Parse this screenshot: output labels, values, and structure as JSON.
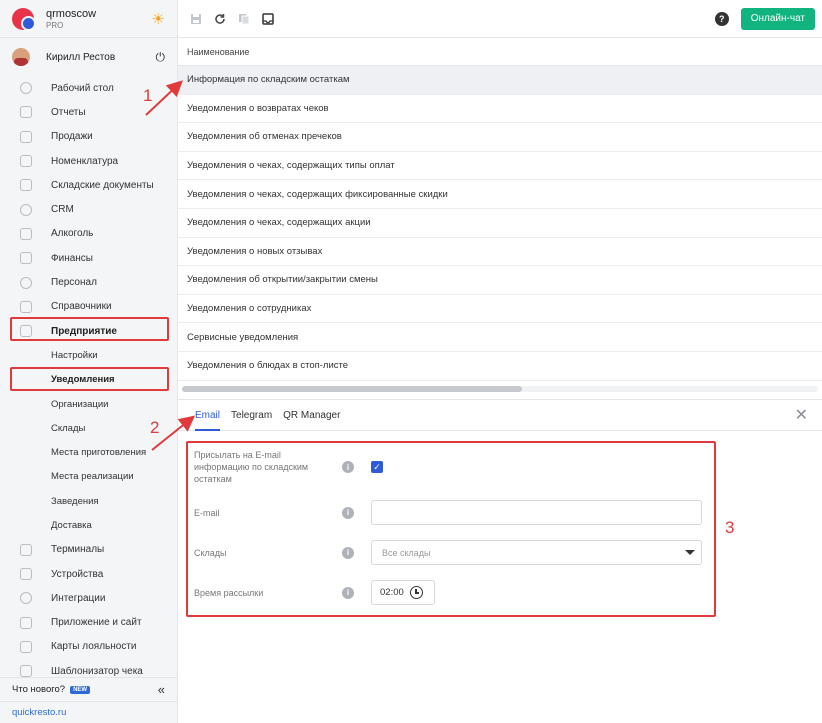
{
  "brand": {
    "name": "qrmoscow",
    "plan": "PRO",
    "theme_icon": "sun-icon"
  },
  "user": {
    "name": "Кирилл Рестов",
    "logout_icon": "power-icon"
  },
  "sidebar": {
    "items": [
      {
        "label": "Рабочий стол",
        "icon": "dashboard-icon"
      },
      {
        "label": "Отчеты",
        "icon": "chart-icon"
      },
      {
        "label": "Продажи",
        "icon": "cart-icon"
      },
      {
        "label": "Номенклатура",
        "icon": "tag-icon"
      },
      {
        "label": "Складские документы",
        "icon": "box-icon"
      },
      {
        "label": "CRM",
        "icon": "people-icon"
      },
      {
        "label": "Алкоголь",
        "icon": "glass-icon"
      },
      {
        "label": "Финансы",
        "icon": "wallet-icon"
      },
      {
        "label": "Персонал",
        "icon": "staff-icon"
      },
      {
        "label": "Справочники",
        "icon": "book-icon"
      },
      {
        "label": "Предприятие",
        "icon": "store-icon"
      }
    ],
    "sub_items": [
      {
        "label": "Настройки"
      },
      {
        "label": "Уведомления"
      },
      {
        "label": "Организации"
      },
      {
        "label": "Склады"
      },
      {
        "label": "Места приготовления"
      },
      {
        "label": "Места реализации"
      },
      {
        "label": "Заведения"
      },
      {
        "label": "Доставка"
      }
    ],
    "items_after": [
      {
        "label": "Терминалы",
        "icon": "terminal-icon"
      },
      {
        "label": "Устройства",
        "icon": "printer-icon"
      },
      {
        "label": "Интеграции",
        "icon": "link-icon"
      },
      {
        "label": "Приложение и сайт",
        "icon": "app-icon"
      },
      {
        "label": "Карты лояльности",
        "icon": "card-icon"
      },
      {
        "label": "Шаблонизатор чека",
        "icon": "receipt-icon"
      }
    ],
    "whats_new": "Что нового?",
    "new_badge": "NEW",
    "site_link": "quickresto.ru"
  },
  "toolbar": {
    "help": "?",
    "chat_label": "Онлайн-чат"
  },
  "table": {
    "header": "Наименование",
    "rows": [
      "Информация по складским остаткам",
      "Уведомления о возвратах чеков",
      "Уведомления об отменах пречеков",
      "Уведомления о чеках, содержащих типы оплат",
      "Уведомления о чеках, содержащих фиксированные скидки",
      "Уведомления о чеках, содержащих акции",
      "Уведомления о новых отзывах",
      "Уведомления об открытии/закрытии смены",
      "Уведомления о сотрудниках",
      "Сервисные уведомления",
      "Уведомления о блюдах в стоп-листе"
    ]
  },
  "tabs": [
    "Email",
    "Telegram",
    "QR Manager"
  ],
  "form": {
    "send_label": "Присылать на E-mail информацию по складским остаткам",
    "send_checked": true,
    "email_label": "E-mail",
    "email_value": "",
    "warehouses_label": "Склады",
    "warehouses_placeholder": "Все склады",
    "time_label": "Время рассылки",
    "time_value": "02:00"
  },
  "annotations": [
    "1",
    "2",
    "3"
  ],
  "colors": {
    "accent": "#2f5bd6",
    "chat": "#11b37e",
    "highlight": "#e03a3a",
    "brand": "#e8334a"
  }
}
